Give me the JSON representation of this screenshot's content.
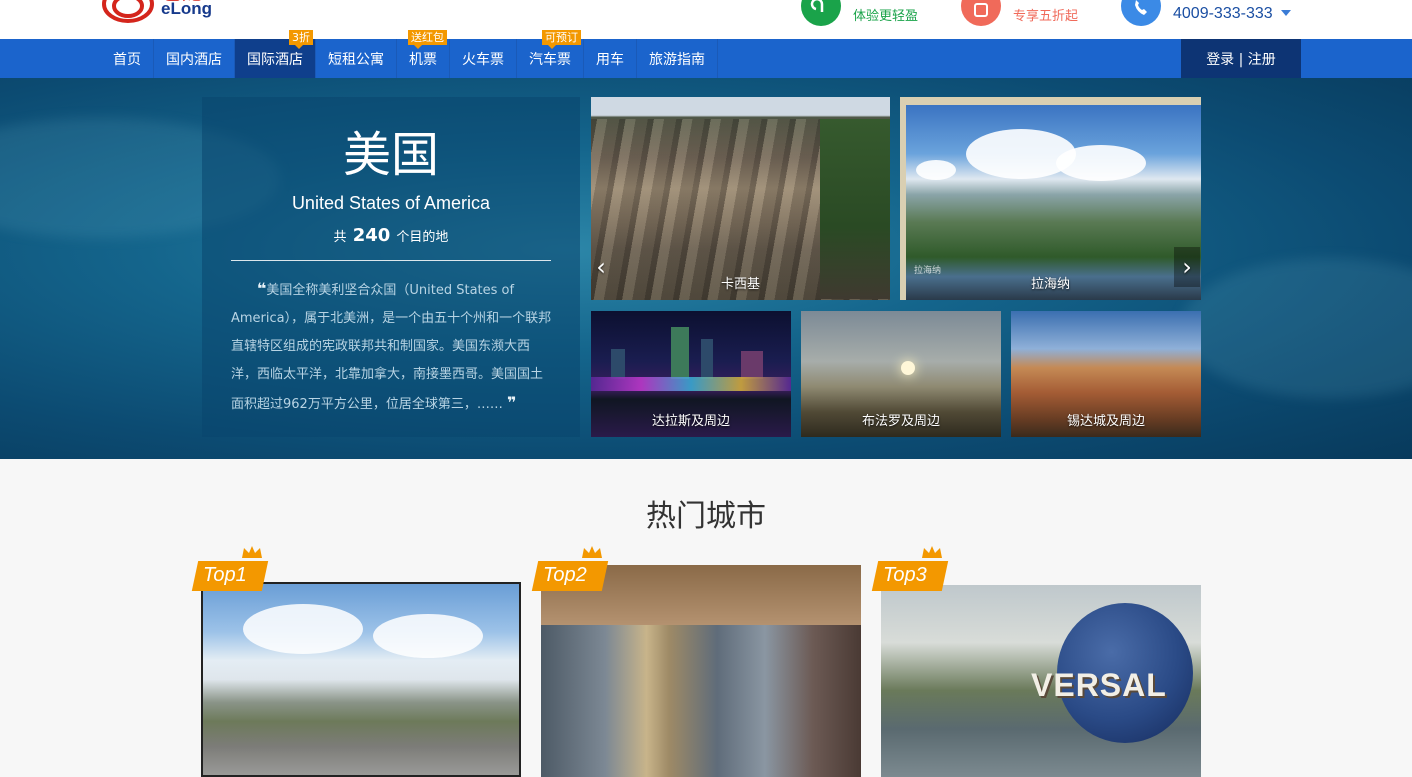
{
  "header": {
    "logo_cn": "艺龙",
    "logo_en": "eLong",
    "app_text": "体验更轻盈",
    "mobile_text": "专享五折起",
    "phone": "4009-333-333",
    "icons": [
      "app-icon",
      "mobile-icon",
      "phone-icon",
      "chevron-down-icon"
    ],
    "colors": {
      "app": "#1aa34a",
      "mobile": "#f06a5a",
      "phone": "#3b8ae6",
      "brand_red": "#d4251c",
      "brand_blue": "#173a8c"
    }
  },
  "nav": {
    "items": [
      {
        "label": "首页"
      },
      {
        "label": "国内酒店"
      },
      {
        "label": "国际酒店",
        "badge": "3折",
        "active": true
      },
      {
        "label": "短租公寓"
      },
      {
        "label": "机票",
        "badge": "送红包"
      },
      {
        "label": "火车票"
      },
      {
        "label": "汽车票",
        "badge": "可预订"
      },
      {
        "label": "用车"
      },
      {
        "label": "旅游指南"
      }
    ],
    "login": "登录 | 注册",
    "colors": {
      "bar": "#1b64cc",
      "active": "#0f3f8c",
      "badge": "#f39800"
    }
  },
  "hero": {
    "country_cn": "美国",
    "country_en": "United States of America",
    "count_prefix": "共",
    "count": "240",
    "count_suffix": "个目的地",
    "quote_open": "❝",
    "quote_close": "❞",
    "description": "美国全称美利坚合众国（United States of America），属于北美洲，是一个由五十个州和一个联邦直辖特区组成的宪政联邦共和制国家。美国东濒大西洋，西临太平洋，北靠加拿大，南接墨西哥。美国国土面积超过962万平方公里，位居全球第三，……",
    "photos": [
      {
        "caption": "卡西基"
      },
      {
        "caption": "拉海纳",
        "watermark": "拉海纳"
      },
      {
        "caption": "达拉斯及周边"
      },
      {
        "caption": "布法罗及周边"
      },
      {
        "caption": "锡达城及周边"
      }
    ],
    "arrows": {
      "left": "‹",
      "right": "›"
    }
  },
  "hot_cities": {
    "title": "热门城市",
    "cards": [
      {
        "badge": "Top1"
      },
      {
        "badge": "Top2"
      },
      {
        "badge": "Top3",
        "sign_text": "VERSAL"
      }
    ]
  }
}
